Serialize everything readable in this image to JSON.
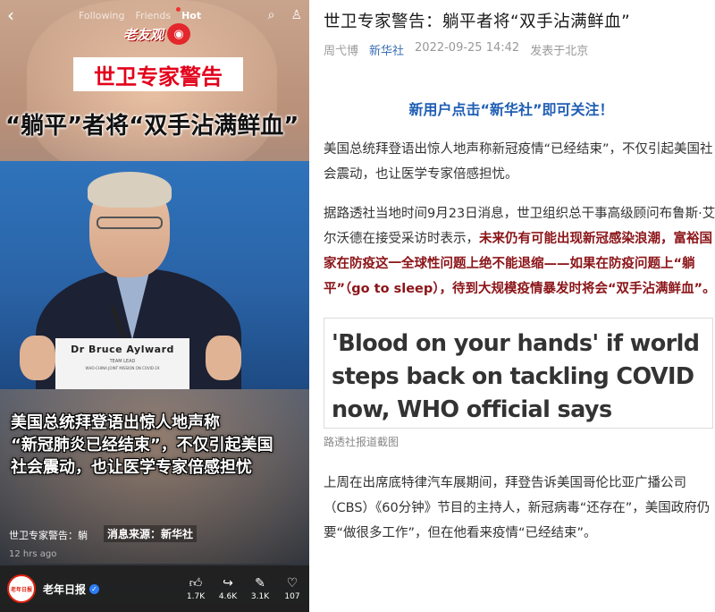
{
  "video_app": {
    "tabs": [
      "Following",
      "Friends",
      "Hot"
    ],
    "logo_text": "老友观",
    "video_title": "世卫专家警告",
    "video_subtitle": "“躺平”者将“双手沾满鲜血”",
    "plaque": {
      "name": "Dr Bruce Aylward",
      "role": "TEAM LEAD",
      "mission": "WHO-CHINA JOINT MISSION ON COVID-19"
    },
    "caption_lines": [
      "美国总统拜登语出惊人地声称",
      "“新冠肺炎已经结束”，不仅引起美国",
      "社会震动，也让医学专家倍感担忧"
    ],
    "info_title": "世卫专家警告：躺",
    "source_label": "消息来源：新华社",
    "time_ago": "12 hrs ago",
    "account_name": "老年日报",
    "avatar_text": "老年日报",
    "stats": [
      {
        "icon": "like-icon",
        "value": "1.7K"
      },
      {
        "icon": "share-icon",
        "value": "4.6K"
      },
      {
        "icon": "comment-icon",
        "value": "3.1K"
      },
      {
        "icon": "favorite-icon",
        "value": "107"
      }
    ]
  },
  "article": {
    "title": "世卫专家警告：躺平者将“双手沾满鲜血”",
    "author": "周弋博",
    "source": "新华社",
    "datetime": "2022-09-25 14:42",
    "location": "发表于北京",
    "promo": "新用户点击“新华社”即可关注！",
    "para1": "美国总统拜登语出惊人地声称新冠疫情“已经结束”，不仅引起美国社会震动，也让医学专家倍感担忧。",
    "para2_plain": "据路透社当地时间9月23日消息，世卫组织总干事高级顾问布鲁斯·艾尔沃德在接受采访时表示，",
    "para2_highlight": "未来仍有可能出现新冠感染浪潮，富裕国家在防疫这一全球性问题上绝不能退缩——如果在防疫问题上“躺平”（go to sleep），待到大规模疫情暴发时将会“双手沾满鲜血”。",
    "quote_lines": [
      "'Blood on your hands' if world",
      "steps back on tackling COVID",
      "now, WHO official says"
    ],
    "quote_caption": "路透社报道截图",
    "para3": "上周在出席底特律汽车展期间，拜登告诉美国哥伦比亚广播公司（CBS）《60分钟》节目的主持人，新冠病毒“还存在”，美国政府仍要“做很多工作”，但在他看来疫情“已经结束”。"
  }
}
